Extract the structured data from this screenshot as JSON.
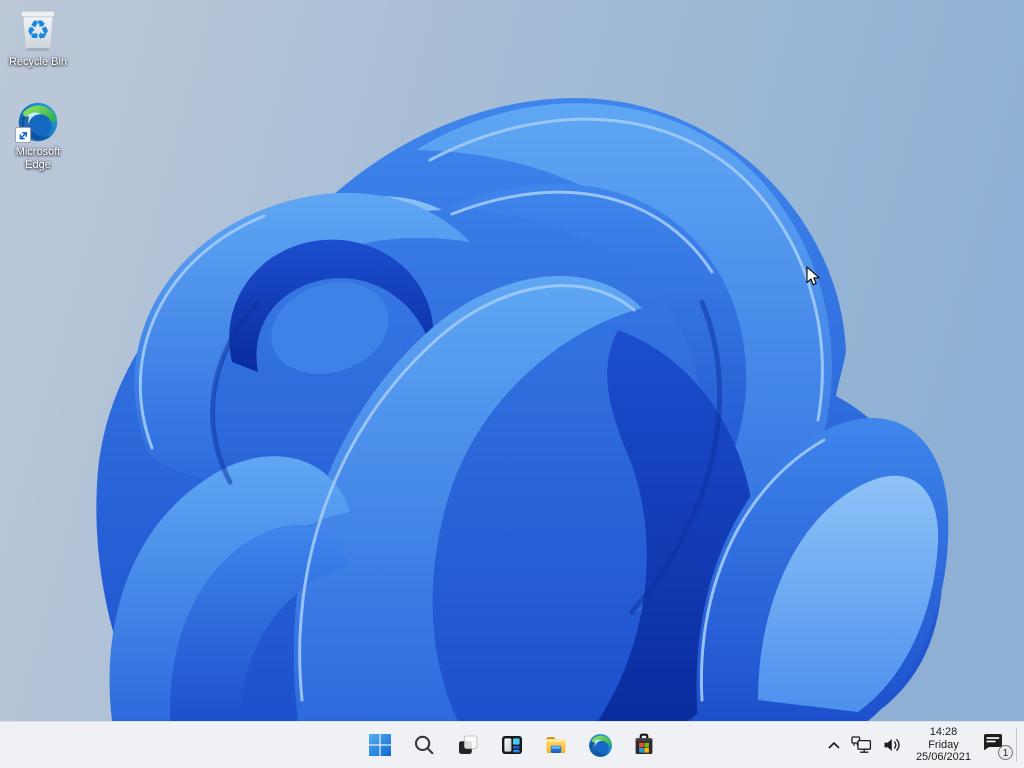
{
  "wallpaper": {
    "name": "windows-11-bloom",
    "bg_left": "#bcc8d8",
    "bg_right": "#8db0d4",
    "petal_light": "#4f9bf0",
    "petal_mid": "#2e6fdb",
    "petal_dark": "#0d35ae"
  },
  "desktop": {
    "icons": [
      {
        "id": "recycle-bin",
        "label": "Recycle Bin"
      },
      {
        "id": "microsoft-edge",
        "label": "Microsoft Edge",
        "label_lines": [
          "Microsoft",
          "Edge"
        ]
      }
    ]
  },
  "taskbar": {
    "background": "#eff1f4",
    "buttons": [
      {
        "id": "start",
        "icon": "windows-logo-icon"
      },
      {
        "id": "search",
        "icon": "search-icon"
      },
      {
        "id": "task-view",
        "icon": "task-view-icon"
      },
      {
        "id": "widgets",
        "icon": "widgets-icon"
      },
      {
        "id": "file-explorer",
        "icon": "folder-icon"
      },
      {
        "id": "edge",
        "icon": "edge-logo-icon"
      },
      {
        "id": "store",
        "icon": "store-bag-icon"
      }
    ],
    "tray": {
      "hidden_icons_icon": "chevron-up-icon",
      "network_icon": "ethernet-network-icon",
      "volume_icon": "speaker-icon",
      "clock": {
        "time": "14:28",
        "day": "Friday",
        "date": "25/06/2021"
      },
      "notifications": {
        "icon": "notification-bubble-icon",
        "badge_count": "1"
      }
    }
  }
}
